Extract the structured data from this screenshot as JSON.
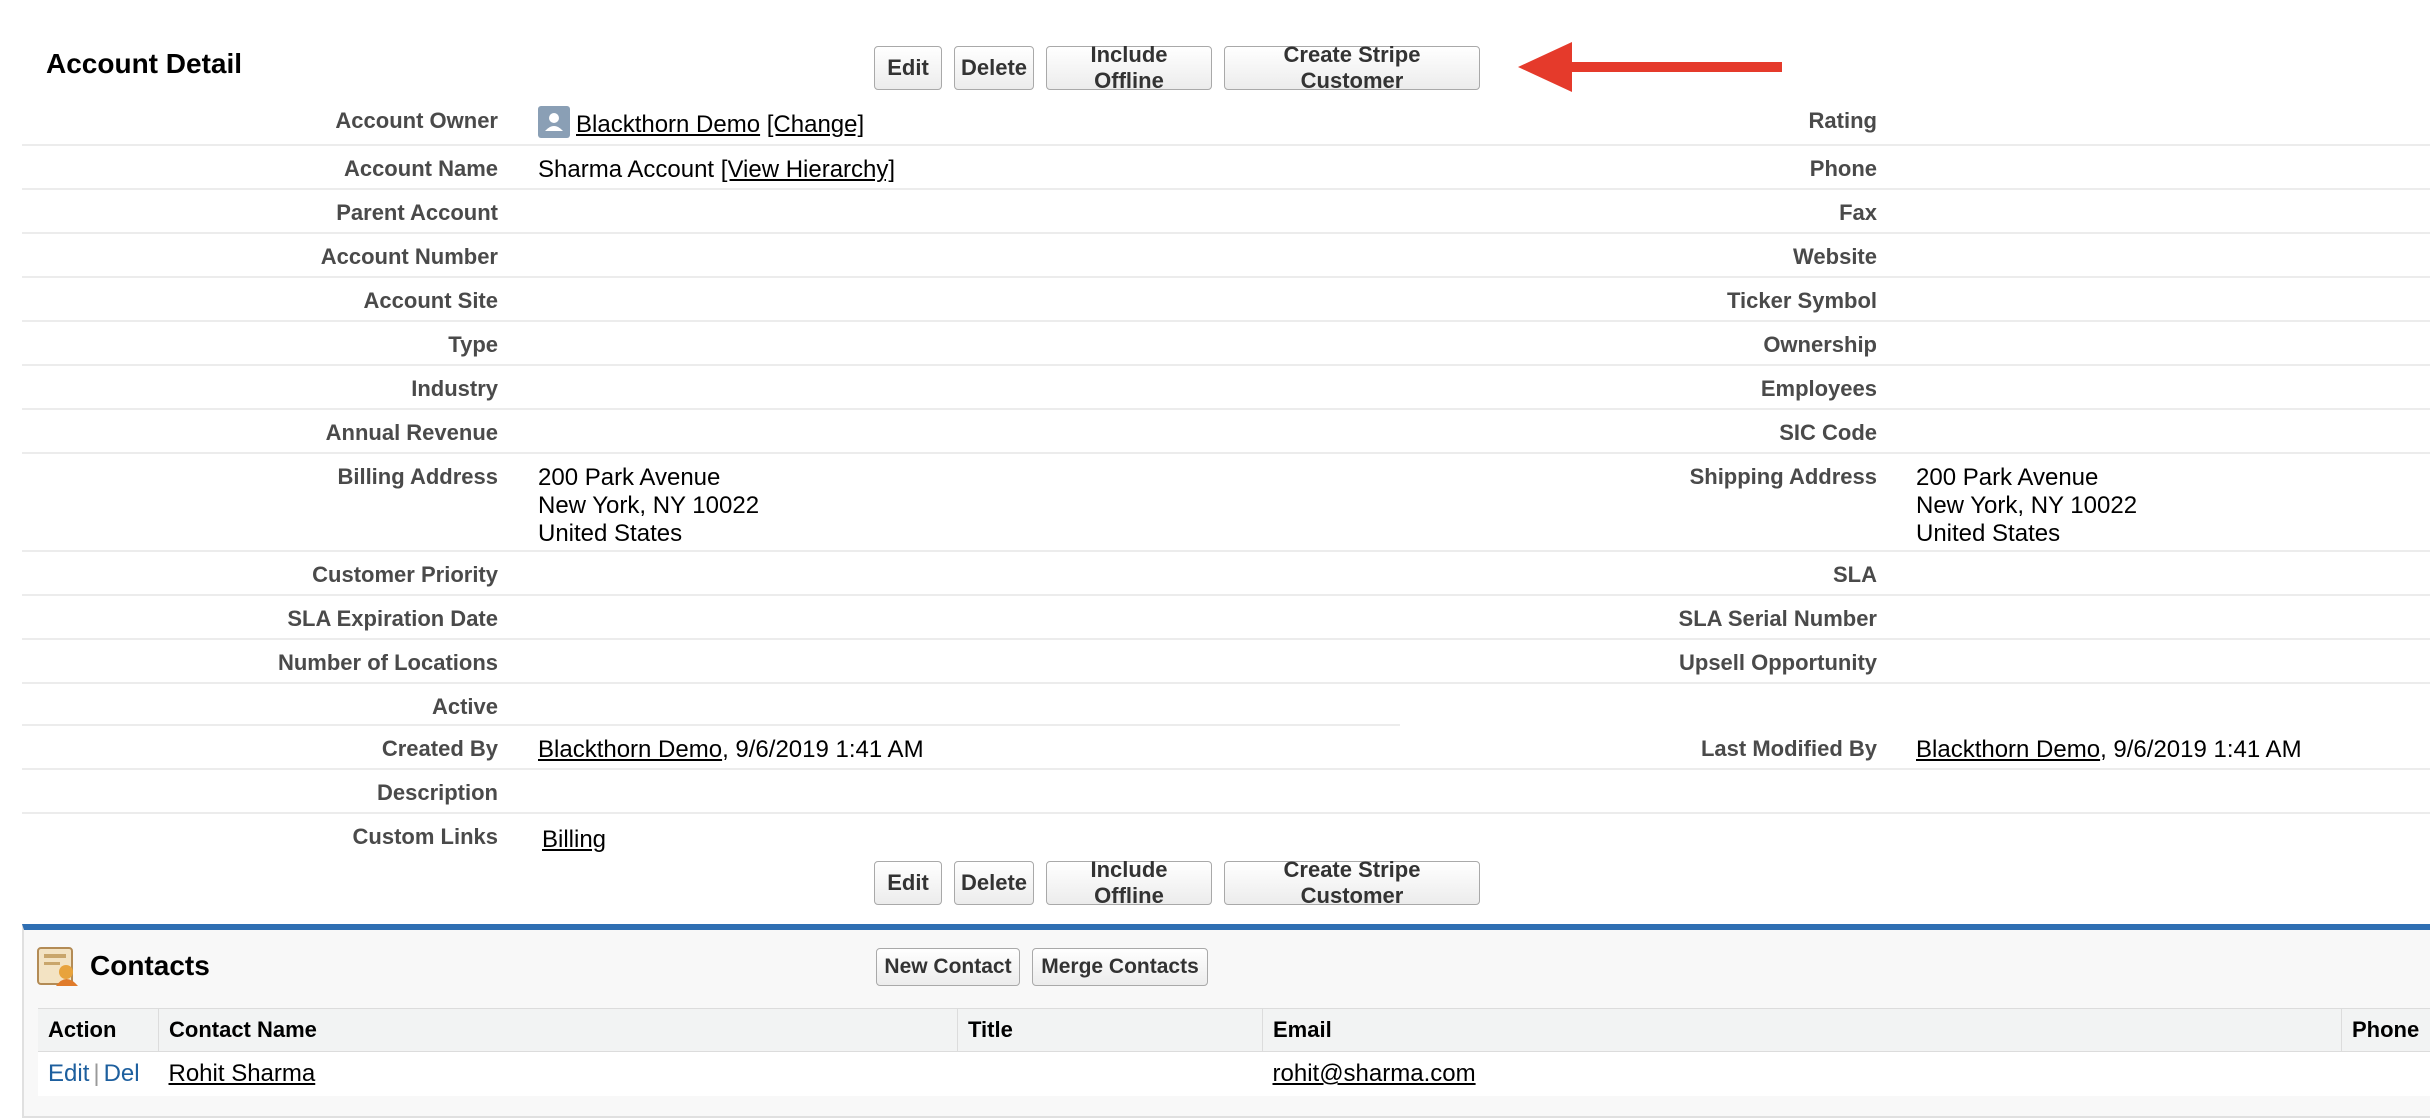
{
  "header": {
    "title": "Account Detail"
  },
  "toolbar": {
    "edit_label": "Edit",
    "delete_label": "Delete",
    "include_offline_label": "Include Offline",
    "create_stripe_label": "Create Stripe Customer"
  },
  "annotation": {
    "arrow_color": "#e53a2b"
  },
  "fields": {
    "account_owner_label": "Account Owner",
    "account_owner_value": "Blackthorn Demo",
    "account_owner_change": "[Change]",
    "rating_label": "Rating",
    "account_name_label": "Account Name",
    "account_name_value": "Sharma Account",
    "view_hierarchy": "[View Hierarchy]",
    "phone_label": "Phone",
    "parent_account_label": "Parent Account",
    "fax_label": "Fax",
    "account_number_label": "Account Number",
    "website_label": "Website",
    "account_site_label": "Account Site",
    "ticker_symbol_label": "Ticker Symbol",
    "type_label": "Type",
    "ownership_label": "Ownership",
    "industry_label": "Industry",
    "employees_label": "Employees",
    "annual_revenue_label": "Annual Revenue",
    "sic_code_label": "SIC Code",
    "billing_address_label": "Billing Address",
    "billing_line1": "200 Park Avenue",
    "billing_line2": "New York, NY 10022",
    "billing_line3": "United States",
    "shipping_address_label": "Shipping Address",
    "shipping_line1": "200 Park Avenue",
    "shipping_line2": "New York, NY 10022",
    "shipping_line3": "United States",
    "customer_priority_label": "Customer Priority",
    "sla_label": "SLA",
    "sla_expiration_label": "SLA Expiration Date",
    "sla_serial_label": "SLA Serial Number",
    "num_locations_label": "Number of Locations",
    "upsell_label": "Upsell Opportunity",
    "active_label": "Active",
    "created_by_label": "Created By",
    "created_by_user": "Blackthorn Demo",
    "created_by_date": ", 9/6/2019 1:41 AM",
    "last_modified_label": "Last Modified By",
    "last_modified_user": "Blackthorn Demo",
    "last_modified_date": ", 9/6/2019 1:41 AM",
    "description_label": "Description",
    "custom_links_label": "Custom Links",
    "billing_link": "Billing"
  },
  "contacts": {
    "title": "Contacts",
    "new_contact_label": "New Contact",
    "merge_contacts_label": "Merge Contacts",
    "columns": [
      "Action",
      "Contact Name",
      "Title",
      "Email",
      "Phone"
    ],
    "rows": [
      {
        "edit": "Edit",
        "separator": "|",
        "del": "Del",
        "name": "Rohit Sharma",
        "title": "",
        "email": "rohit@sharma.com",
        "phone": ""
      }
    ]
  }
}
